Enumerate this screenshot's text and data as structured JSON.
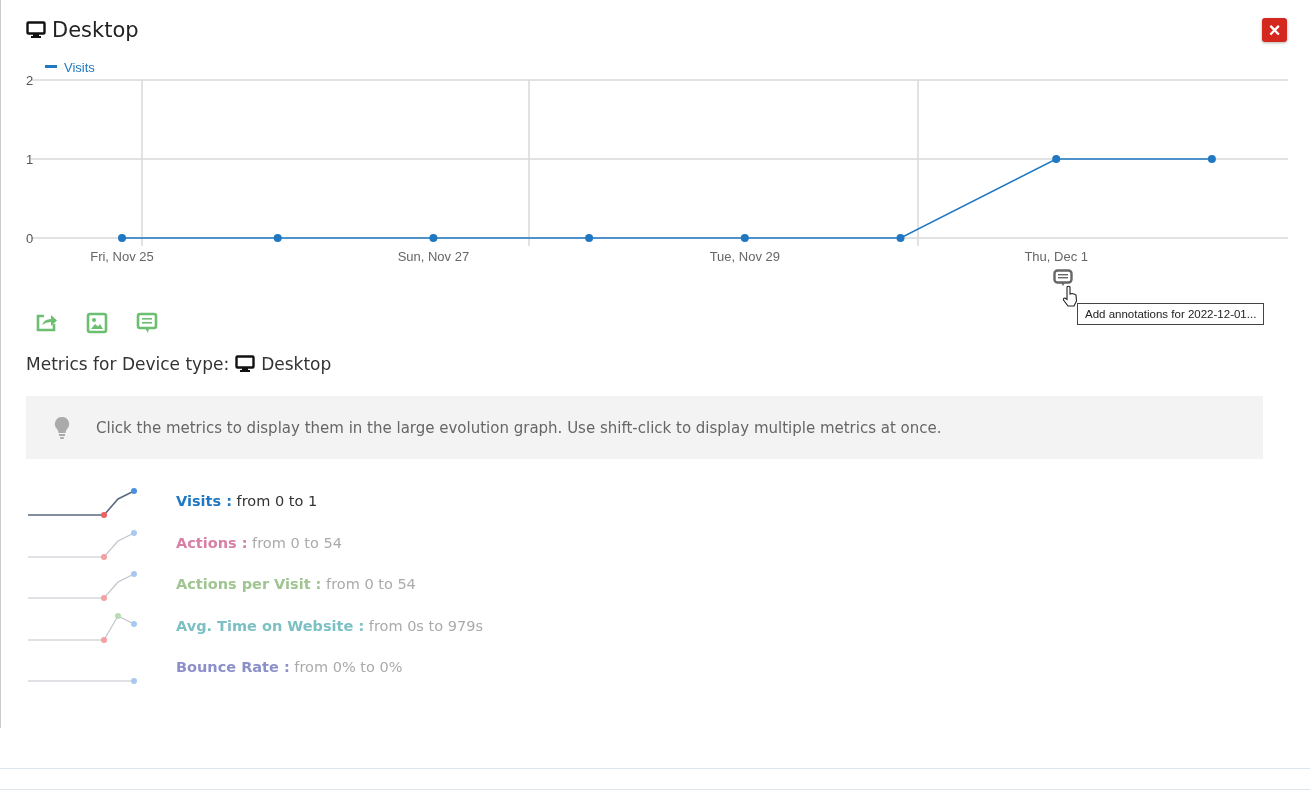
{
  "header": {
    "title": "Desktop",
    "close_label": "×"
  },
  "chart": {
    "chart_data": {
      "type": "line",
      "categories": [
        "Fri, Nov 25",
        null,
        "Sun, Nov 27",
        null,
        "Tue, Nov 29",
        null,
        "Thu, Dec 1",
        null
      ],
      "series": [
        {
          "name": "Visits",
          "color": "#1f78c1",
          "marker": "circle",
          "values": [
            0,
            0,
            0,
            0,
            0,
            0,
            1,
            1
          ]
        }
      ],
      "ylim": [
        0,
        2
      ],
      "yticks": [
        0,
        1,
        2
      ]
    },
    "tooltip": "Add annotations for 2022-12-01..."
  },
  "metrics_title": {
    "prefix": "Metrics for Device type:",
    "device": "Desktop"
  },
  "hint": "Click the metrics to display them in the large evolution graph. Use shift-click to display multiple metrics at once.",
  "metrics": [
    {
      "name": "Visits :",
      "range": "from 0 to 1",
      "color": "#1f78c1",
      "selected": true,
      "kind": "rise"
    },
    {
      "name": "Actions :",
      "range": "from 0 to 54",
      "color": "#d87fa6",
      "selected": false,
      "kind": "rise"
    },
    {
      "name": "Actions per Visit :",
      "range": "from 0 to 54",
      "color": "#9fc591",
      "selected": false,
      "kind": "rise"
    },
    {
      "name": "Avg. Time on Website :",
      "range": "from 0s to 979s",
      "color": "#7cc0c4",
      "selected": false,
      "kind": "peak"
    },
    {
      "name": "Bounce Rate :",
      "range": "from 0% to 0%",
      "color": "#8b90c9",
      "selected": false,
      "kind": "flat"
    }
  ]
}
